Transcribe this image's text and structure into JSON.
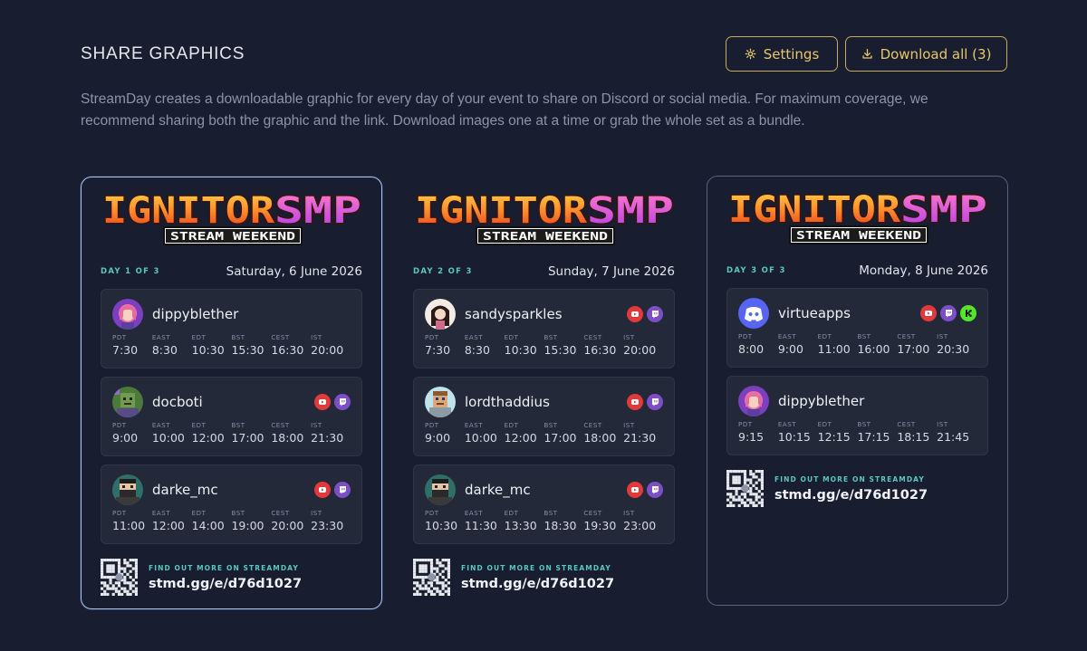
{
  "header": {
    "title": "SHARE GRAPHICS",
    "description": "StreamDay creates a downloadable graphic for every day of your event to share on Discord or social media. For maximum coverage, we recommend sharing both the graphic and the link. Download images one at a time or grab the whole set as a bundle.",
    "settings_label": "Settings",
    "download_label": "Download all (3)"
  },
  "logo": {
    "line1": "IGNITORSMP",
    "line2": "STREAM WEEKEND"
  },
  "footer": {
    "label": "FIND OUT MORE ON STREAMDAY",
    "url": "stmd.gg/e/d76d1027"
  },
  "cards": [
    {
      "day_label": "DAY 1 OF 3",
      "date": "Saturday, 6 June 2026",
      "slots": [
        {
          "name": "dippyblether",
          "avatar": "pink-hair-avatar",
          "platforms": [],
          "times": [
            [
              "PDT",
              "7:30"
            ],
            [
              "EAST",
              "8:30"
            ],
            [
              "EDT",
              "10:30"
            ],
            [
              "BST",
              "15:30"
            ],
            [
              "CEST",
              "16:30"
            ],
            [
              "IST",
              "20:00"
            ]
          ]
        },
        {
          "name": "docboti",
          "avatar": "minecraft-green-avatar",
          "platforms": [
            "youtube",
            "twitch"
          ],
          "times": [
            [
              "PDT",
              "9:00"
            ],
            [
              "EAST",
              "10:00"
            ],
            [
              "EDT",
              "12:00"
            ],
            [
              "BST",
              "17:00"
            ],
            [
              "CEST",
              "18:00"
            ],
            [
              "IST",
              "21:30"
            ]
          ]
        },
        {
          "name": "darke_mc",
          "avatar": "minecraft-bearded-avatar",
          "platforms": [
            "youtube",
            "twitch"
          ],
          "times": [
            [
              "PDT",
              "11:00"
            ],
            [
              "EAST",
              "12:00"
            ],
            [
              "EDT",
              "14:00"
            ],
            [
              "BST",
              "19:00"
            ],
            [
              "CEST",
              "20:00"
            ],
            [
              "IST",
              "23:30"
            ]
          ]
        }
      ]
    },
    {
      "day_label": "DAY 2 OF 3",
      "date": "Sunday, 7 June 2026",
      "slots": [
        {
          "name": "sandysparkles",
          "avatar": "dark-hair-avatar",
          "platforms": [
            "youtube",
            "twitch"
          ],
          "times": [
            [
              "PDT",
              "7:30"
            ],
            [
              "EAST",
              "8:30"
            ],
            [
              "EDT",
              "10:30"
            ],
            [
              "BST",
              "15:30"
            ],
            [
              "CEST",
              "16:30"
            ],
            [
              "IST",
              "20:00"
            ]
          ]
        },
        {
          "name": "lordthaddius",
          "avatar": "minecraft-knight-avatar",
          "platforms": [
            "youtube",
            "twitch"
          ],
          "times": [
            [
              "PDT",
              "9:00"
            ],
            [
              "EAST",
              "10:00"
            ],
            [
              "EDT",
              "12:00"
            ],
            [
              "BST",
              "17:00"
            ],
            [
              "CEST",
              "18:00"
            ],
            [
              "IST",
              "21:30"
            ]
          ]
        },
        {
          "name": "darke_mc",
          "avatar": "minecraft-bearded-avatar",
          "platforms": [
            "youtube",
            "twitch"
          ],
          "times": [
            [
              "PDT",
              "10:30"
            ],
            [
              "EAST",
              "11:30"
            ],
            [
              "EDT",
              "13:30"
            ],
            [
              "BST",
              "18:30"
            ],
            [
              "CEST",
              "19:30"
            ],
            [
              "IST",
              "23:00"
            ]
          ]
        }
      ]
    },
    {
      "day_label": "DAY 3 OF 3",
      "date": "Monday, 8 June 2026",
      "slots": [
        {
          "name": "virtueapps",
          "avatar": "discord-avatar",
          "platforms": [
            "youtube",
            "twitch",
            "kick"
          ],
          "times": [
            [
              "PDT",
              "8:00"
            ],
            [
              "EAST",
              "9:00"
            ],
            [
              "EDT",
              "11:00"
            ],
            [
              "BST",
              "16:00"
            ],
            [
              "CEST",
              "17:00"
            ],
            [
              "IST",
              "20:30"
            ]
          ]
        },
        {
          "name": "dippyblether",
          "avatar": "pink-hair-avatar",
          "platforms": [],
          "times": [
            [
              "PDT",
              "9:15"
            ],
            [
              "EAST",
              "10:15"
            ],
            [
              "EDT",
              "12:15"
            ],
            [
              "BST",
              "17:15"
            ],
            [
              "CEST",
              "18:15"
            ],
            [
              "IST",
              "21:45"
            ]
          ]
        }
      ]
    }
  ],
  "colors": {
    "background": "#181d2f",
    "accent_gold": "#e8c76c",
    "accent_teal": "#5ac8c0",
    "youtube": "#e23a3a",
    "twitch": "#7c4fc7",
    "kick": "#53e62a"
  }
}
